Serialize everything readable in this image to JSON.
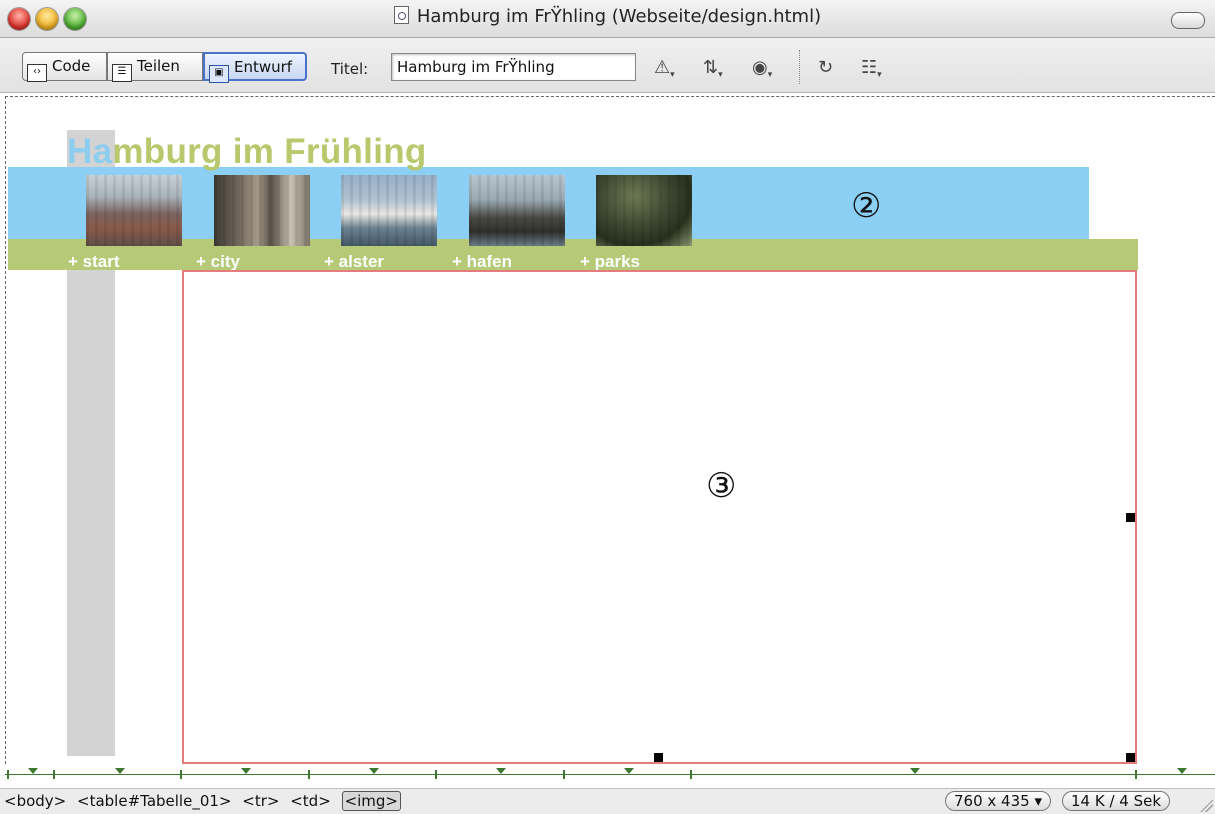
{
  "window": {
    "title": "Hamburg im FrŸhling (Webseite/design.html)"
  },
  "toolbar": {
    "view_buttons": [
      "Code",
      "Teilen",
      "Entwurf"
    ],
    "active_view": "Entwurf",
    "titel_label": "Titel:",
    "titel_value": "Hamburg im FrŸhling",
    "icons": [
      "browser-check-warning-icon",
      "file-transfer-icon",
      "preview-globe-icon",
      "refresh-icon",
      "view-options-icon"
    ]
  },
  "design": {
    "site_title_highlight": "Ha",
    "site_title_rest": "mburg im Frühling",
    "colors": {
      "blue_bar": "#8ccff4",
      "green_bar": "#b6c977",
      "title_green": "#b7c96c",
      "title_blue": "#8ccdf0",
      "selection_border": "#e57c7c"
    },
    "photos": [
      "photo-start",
      "photo-city",
      "photo-alster",
      "photo-hafen",
      "photo-parks"
    ],
    "nav": [
      "+ start",
      "+ city",
      "+ alster",
      "+ hafen",
      "+ parks"
    ],
    "marker_2": "②",
    "marker_3": "③"
  },
  "status": {
    "breadcrumbs": [
      "<body>",
      "<table#Tabelle_01>",
      "<tr>",
      "<td>",
      "<img>"
    ],
    "selected_crumb": "<img>",
    "window_size": "760 x 435",
    "size_caret": "▾",
    "download": "14 K / 4 Sek"
  }
}
